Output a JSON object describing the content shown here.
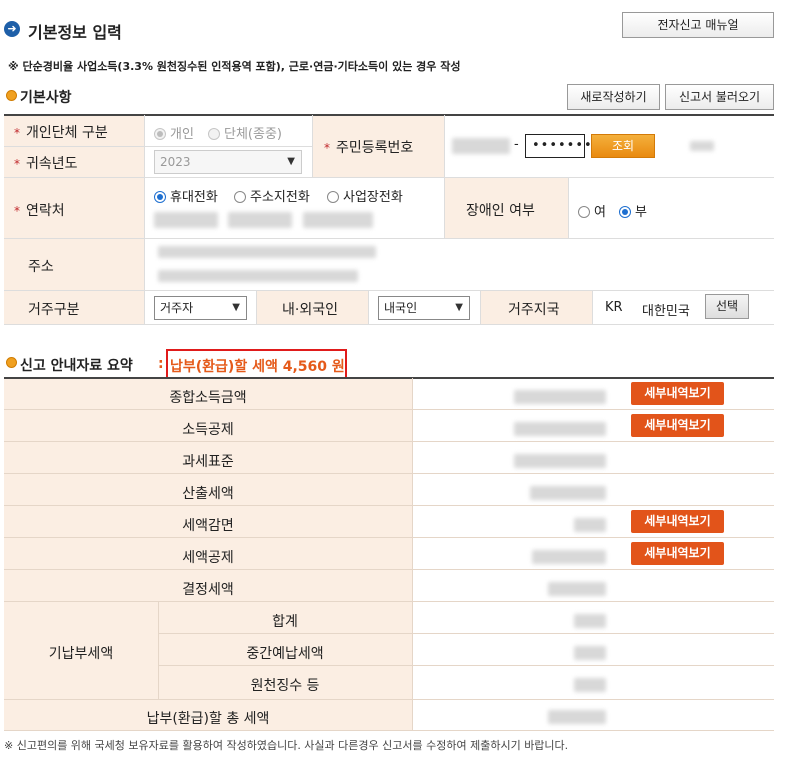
{
  "header": {
    "title": "기본정보 입력",
    "title_icon": "arrow-right-icon",
    "manual_button": "전자신고 매뉴얼"
  },
  "notice": "※ 단순경비율 사업소득(3.3% 원천징수된 인적용역 포함), 근로·연금·기타소득이 있는 경우 작성",
  "basic": {
    "section_title": "기본사항",
    "new_button": "새로작성하기",
    "load_button": "신고서 불러오기",
    "entity_label": "개인단체 구분",
    "entity_options": [
      "개인",
      "단체(종중)"
    ],
    "entity_selected": "개인",
    "year_label": "귀속년도",
    "year_value": "2023",
    "ssn_label": "주민등록번호",
    "ssn_dash": "-",
    "ssn_back": "•••••••",
    "lookup_button": "조회",
    "contact_label": "연락처",
    "contact_options": [
      "휴대전화",
      "주소지전화",
      "사업장전화"
    ],
    "contact_selected": "휴대전화",
    "disability_label": "장애인 여부",
    "disability_options": [
      "여",
      "부"
    ],
    "disability_selected": "부",
    "address_label": "주소",
    "residence_label": "거주구분",
    "residence_value": "거주자",
    "nationality_label": "내·외국인",
    "nationality_value": "내국인",
    "country_label": "거주지국",
    "country_code": "KR",
    "country_name": "대한민국",
    "select_button": "선택"
  },
  "summary": {
    "section_title": "신고 안내자료 요약",
    "colon": ":",
    "highlight": "납부(환급)할 세액 4,560 원",
    "detail_button": "세부내역보기",
    "rows": [
      "종합소득금액",
      "소득공제",
      "과세표준",
      "산출세액",
      "세액감면",
      "세액공제",
      "결정세액"
    ],
    "prepaid_label": "기납부세액",
    "prepaid_rows": [
      "합계",
      "중간예납세액",
      "원천징수 등"
    ],
    "total_label": "납부(환급)할 총 세액"
  },
  "footer": "※ 신고편의를 위해 국세청 보유자료를 활용하여 작성하였습니다. 사실과 다른경우 신고서를 수정하여 제출하시기 바랍니다.",
  "colors": {
    "label_bg": "#fbeee3",
    "accent_orange": "#e2541a",
    "highlight_border": "#e01b1b",
    "highlight_text": "#e55a1a"
  }
}
